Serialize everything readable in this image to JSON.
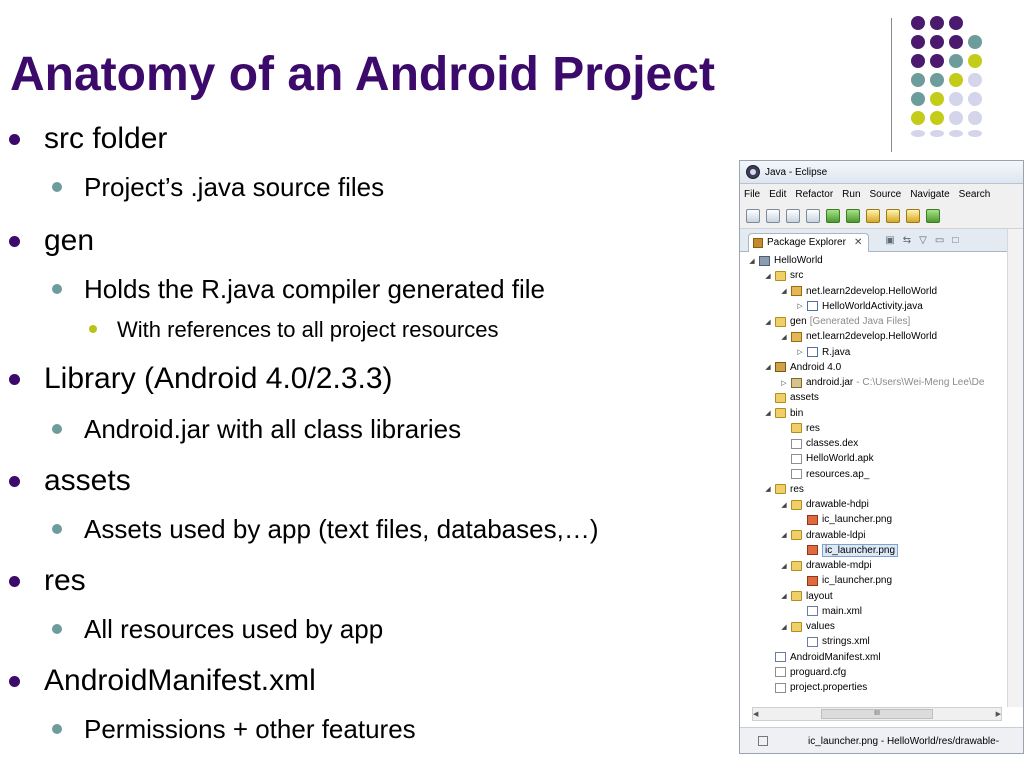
{
  "slide": {
    "title": "Anatomy of an Android Project",
    "accent": "#3b0a6b",
    "bullets": [
      {
        "level": 1,
        "text": "src folder"
      },
      {
        "level": 2,
        "text": "Project’s .java source files"
      },
      {
        "level": 1,
        "text": "gen"
      },
      {
        "level": 2,
        "text": "Holds the R.java compiler generated file"
      },
      {
        "level": 3,
        "text": "With references to all project resources"
      },
      {
        "level": 1,
        "text": "Library (Android 4.0/2.3.3)"
      },
      {
        "level": 2,
        "text": "Android.jar with all class libraries"
      },
      {
        "level": 1,
        "text": "assets"
      },
      {
        "level": 2,
        "text": "Assets used by app (text files, databases,…)"
      },
      {
        "level": 1,
        "text": "res"
      },
      {
        "level": 2,
        "text": "All resources used by app"
      },
      {
        "level": 1,
        "text": "AndroidManifest.xml"
      },
      {
        "level": 2,
        "text": "Permissions + other features"
      }
    ],
    "decor_colors": {
      "purple": "#4b1a6e",
      "teal": "#6d9c9c",
      "lime": "#c4cc1a",
      "lavender": "#d4d4ea"
    }
  },
  "eclipse": {
    "window_title": "Java - Eclipse",
    "menu": [
      "File",
      "Edit",
      "Refactor",
      "Run",
      "Source",
      "Navigate",
      "Search"
    ],
    "view_tab": "Package Explorer",
    "tab_close": "✕",
    "tree": [
      {
        "depth": 0,
        "arrow": "◢",
        "icon": "project",
        "label": "HelloWorld",
        "note": ""
      },
      {
        "depth": 1,
        "arrow": "◢",
        "icon": "folder",
        "label": "src",
        "note": ""
      },
      {
        "depth": 2,
        "arrow": "◢",
        "icon": "pkg",
        "label": "net.learn2develop.HelloWorld",
        "note": ""
      },
      {
        "depth": 3,
        "arrow": "▷",
        "icon": "java",
        "label": "HelloWorldActivity.java",
        "note": ""
      },
      {
        "depth": 1,
        "arrow": "◢",
        "icon": "folder",
        "label": "gen",
        "note": "[Generated Java Files]"
      },
      {
        "depth": 2,
        "arrow": "◢",
        "icon": "pkg",
        "label": "net.learn2develop.HelloWorld",
        "note": ""
      },
      {
        "depth": 3,
        "arrow": "▷",
        "icon": "java",
        "label": "R.java",
        "note": ""
      },
      {
        "depth": 1,
        "arrow": "◢",
        "icon": "lib",
        "label": "Android 4.0",
        "note": ""
      },
      {
        "depth": 2,
        "arrow": "▷",
        "icon": "jar",
        "label": "android.jar",
        "note": "- C:\\Users\\Wei-Meng Lee\\De"
      },
      {
        "depth": 1,
        "arrow": "",
        "icon": "folder",
        "label": "assets",
        "note": ""
      },
      {
        "depth": 1,
        "arrow": "◢",
        "icon": "folder",
        "label": "bin",
        "note": ""
      },
      {
        "depth": 2,
        "arrow": "",
        "icon": "folder",
        "label": "res",
        "note": ""
      },
      {
        "depth": 2,
        "arrow": "",
        "icon": "file",
        "label": "classes.dex",
        "note": ""
      },
      {
        "depth": 2,
        "arrow": "",
        "icon": "file",
        "label": "HelloWorld.apk",
        "note": ""
      },
      {
        "depth": 2,
        "arrow": "",
        "icon": "file",
        "label": "resources.ap_",
        "note": ""
      },
      {
        "depth": 1,
        "arrow": "◢",
        "icon": "folder",
        "label": "res",
        "note": ""
      },
      {
        "depth": 2,
        "arrow": "◢",
        "icon": "folder",
        "label": "drawable-hdpi",
        "note": ""
      },
      {
        "depth": 3,
        "arrow": "",
        "icon": "png",
        "label": "ic_launcher.png",
        "note": ""
      },
      {
        "depth": 2,
        "arrow": "◢",
        "icon": "folder",
        "label": "drawable-ldpi",
        "note": ""
      },
      {
        "depth": 3,
        "arrow": "",
        "icon": "png",
        "label": "ic_launcher.png",
        "note": "",
        "selected": true
      },
      {
        "depth": 2,
        "arrow": "◢",
        "icon": "folder",
        "label": "drawable-mdpi",
        "note": ""
      },
      {
        "depth": 3,
        "arrow": "",
        "icon": "png",
        "label": "ic_launcher.png",
        "note": ""
      },
      {
        "depth": 2,
        "arrow": "◢",
        "icon": "folder",
        "label": "layout",
        "note": ""
      },
      {
        "depth": 3,
        "arrow": "",
        "icon": "xml",
        "label": "main.xml",
        "note": ""
      },
      {
        "depth": 2,
        "arrow": "◢",
        "icon": "folder",
        "label": "values",
        "note": ""
      },
      {
        "depth": 3,
        "arrow": "",
        "icon": "xml",
        "label": "strings.xml",
        "note": ""
      },
      {
        "depth": 1,
        "arrow": "",
        "icon": "xml",
        "label": "AndroidManifest.xml",
        "note": ""
      },
      {
        "depth": 1,
        "arrow": "",
        "icon": "file",
        "label": "proguard.cfg",
        "note": ""
      },
      {
        "depth": 1,
        "arrow": "",
        "icon": "file",
        "label": "project.properties",
        "note": ""
      }
    ],
    "hscroll_thumb": "III",
    "status_text": "ic_launcher.png - HelloWorld/res/drawable-"
  }
}
